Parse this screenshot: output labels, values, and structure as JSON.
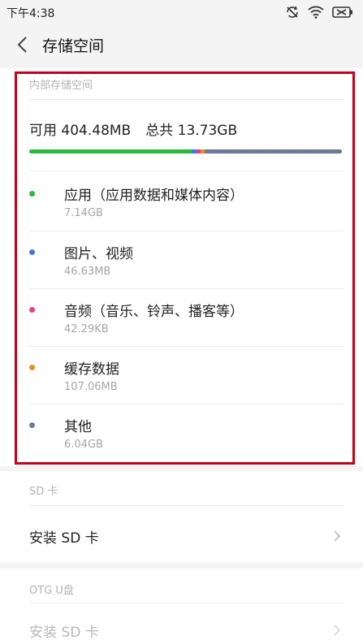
{
  "status_bar": {
    "time": "下午4:38",
    "icons": [
      "sync-off-icon",
      "wifi-icon",
      "battery-icon"
    ]
  },
  "header": {
    "title": "存储空间",
    "back_icon": "chevron-left-icon"
  },
  "internal_storage": {
    "section_label": "内部存储空间",
    "available_label": "可用 404.48MB",
    "total_label": "总共 13.73GB",
    "usage_fraction": 0.9716,
    "categories": [
      {
        "name": "应用（应用数据和媒体内容）",
        "size": "7.14GB",
        "color": "#2db83d",
        "bar_fraction": 0.52
      },
      {
        "name": "图片、视频",
        "size": "46.63MB",
        "color": "#3b7be0",
        "bar_fraction": 0.015
      },
      {
        "name": "音频（音乐、铃声、播客等）",
        "size": "42.29KB",
        "color": "#e83b8a",
        "bar_fraction": 0.012
      },
      {
        "name": "缓存数据",
        "size": "107.06MB",
        "color": "#f08c1e",
        "bar_fraction": 0.015
      },
      {
        "name": "其他",
        "size": "6.04GB",
        "color": "#6a7a99",
        "bar_fraction": 0.438
      }
    ]
  },
  "sd_card": {
    "section_label": "SD 卡",
    "install_label": "安装 SD 卡"
  },
  "otg": {
    "section_label": "OTG U盘",
    "install_label": "安装 SD 卡"
  },
  "colors": {
    "highlight": "#c40018",
    "background": "#f4f4f4"
  }
}
